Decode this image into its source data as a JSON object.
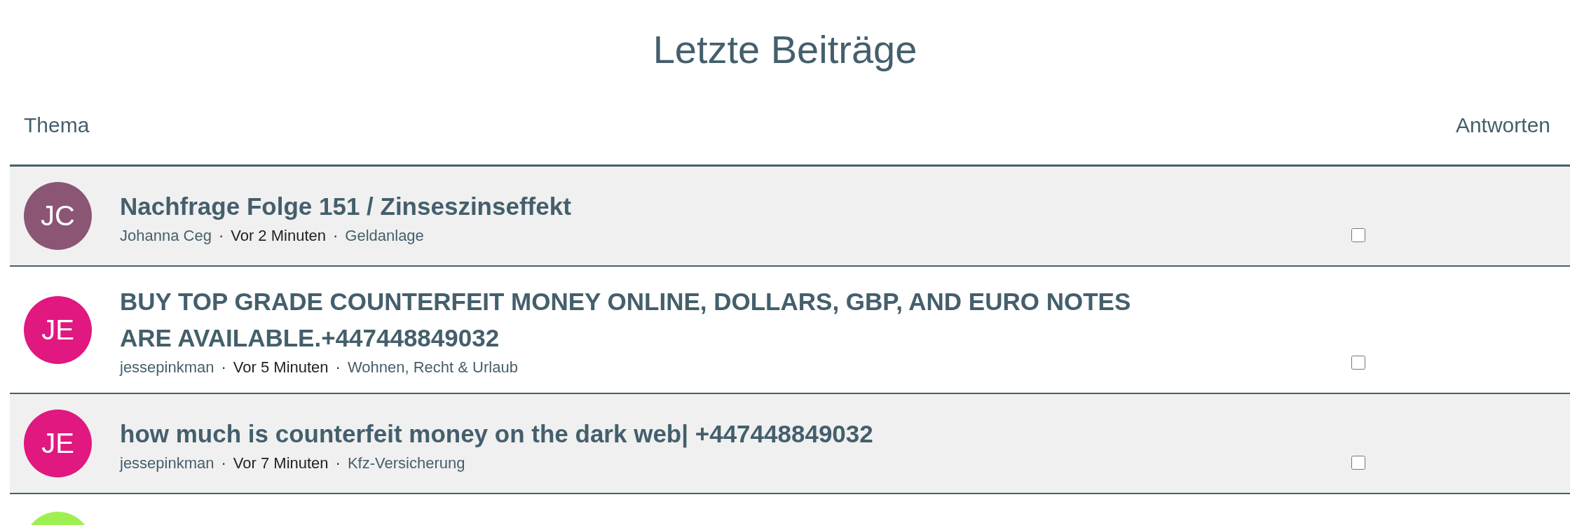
{
  "page_title": "Letzte Beiträge",
  "columns": [
    "Thema",
    "Antworten"
  ],
  "topics": [
    {
      "avatar": "JC",
      "color": "#8b5574",
      "title": "Nachfrage Folge 151 / Zinseszinseffekt",
      "author": "Johanna Ceg",
      "separators": [
        "·",
        "·"
      ],
      "time": "Vor 2 Minuten",
      "category": "Geldanlage",
      "checked": false
    },
    {
      "avatar": "JE",
      "color": "#e0187f",
      "title": "BUY TOP GRADE COUNTERFEIT MONEY ONLINE, DOLLARS, GBP, AND EURO NOTES ARE AVAILABLE.+447448849032",
      "author": "jessepinkman",
      "separators": [
        "·",
        "·"
      ],
      "time": "Vor 5 Minuten",
      "category": "Wohnen, Recht & Urlaub",
      "checked": false
    },
    {
      "avatar": "JE",
      "color": "#e0187f",
      "title": "how much is counterfeit money on the dark web| +447448849032",
      "author": "jessepinkman",
      "separators": [
        "·",
        "·"
      ],
      "time": "Vor 7 Minuten",
      "category": "Kfz-Versicherung",
      "checked": false
    },
    {
      "color": "#9ef050"
    }
  ]
}
